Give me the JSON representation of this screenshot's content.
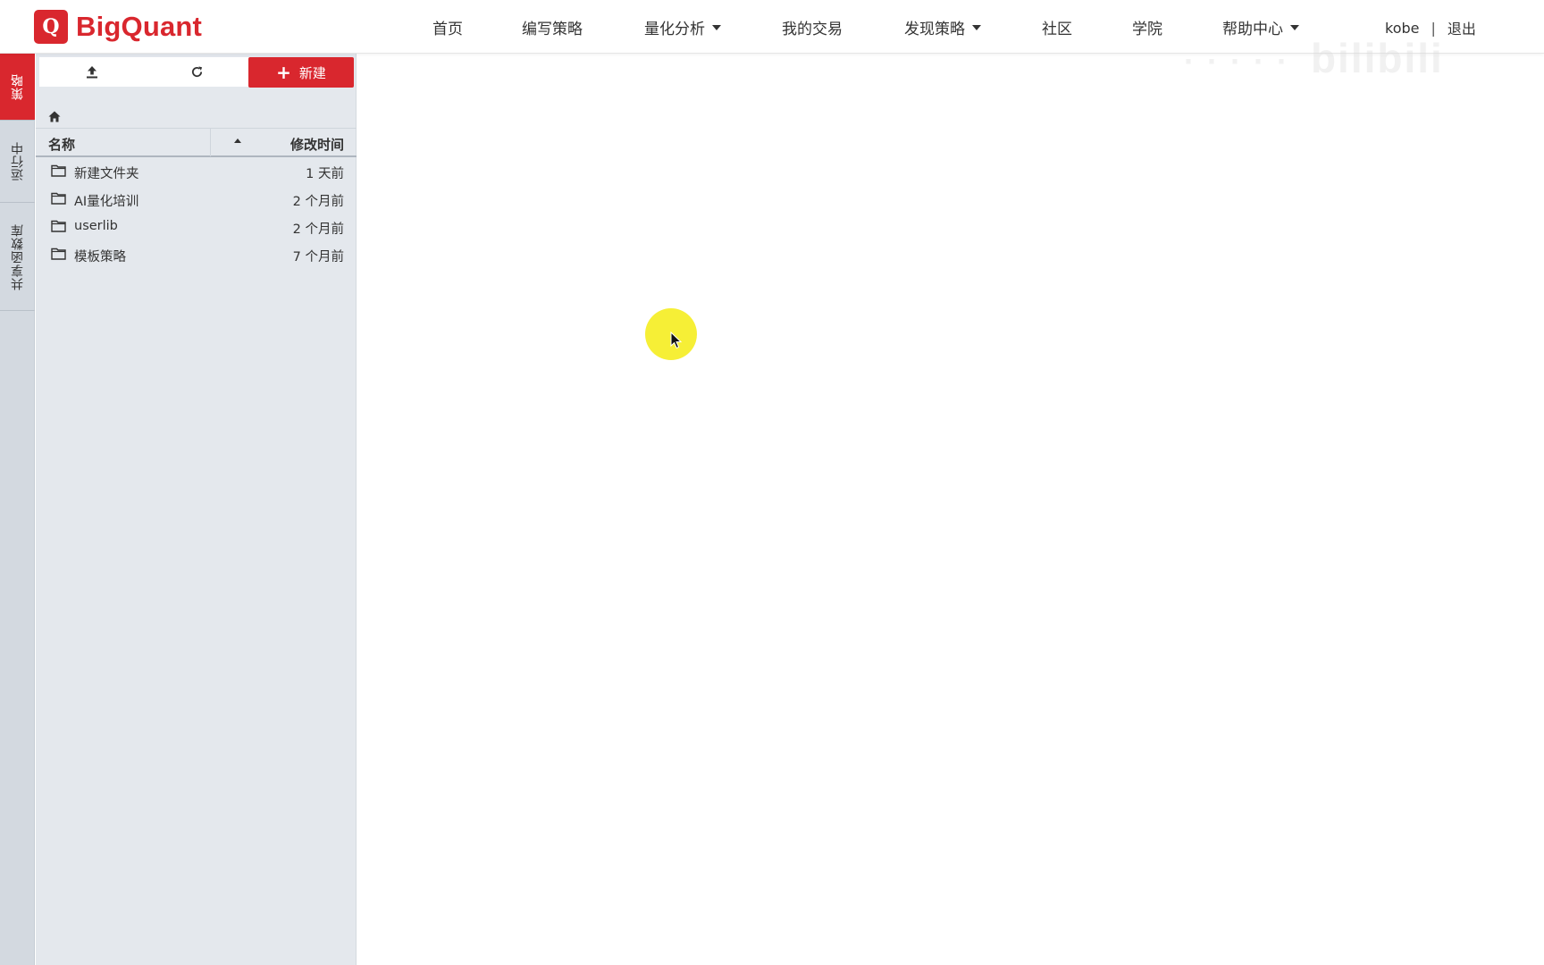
{
  "brand": {
    "logo_letter": "Q",
    "name": "BigQuant",
    "color": "#d9272e"
  },
  "nav": {
    "items": [
      {
        "label": "首页",
        "dropdown": false
      },
      {
        "label": "编写策略",
        "dropdown": false
      },
      {
        "label": "量化分析",
        "dropdown": true
      },
      {
        "label": "我的交易",
        "dropdown": false
      },
      {
        "label": "发现策略",
        "dropdown": true
      },
      {
        "label": "社区",
        "dropdown": false
      },
      {
        "label": "学院",
        "dropdown": false
      },
      {
        "label": "帮助中心",
        "dropdown": true
      }
    ],
    "user": "kobe",
    "separator": "|",
    "logout": "退出"
  },
  "watermark": "bilibili",
  "side_tabs": [
    {
      "label": "策略",
      "active": true
    },
    {
      "label": "运行中",
      "active": false
    },
    {
      "label": "共享函数库",
      "active": false
    }
  ],
  "file_panel": {
    "toolbar": {
      "upload_icon": "upload-icon",
      "refresh_icon": "refresh-icon"
    },
    "new_button": "新建",
    "breadcrumb_icon": "home-icon",
    "columns": {
      "name": "名称",
      "modified": "修改时间"
    },
    "rows": [
      {
        "name": "新建文件夹",
        "modified": "1 天前",
        "icon": "folder-icon"
      },
      {
        "name": "AI量化培训",
        "modified": "2 个月前",
        "icon": "folder-icon"
      },
      {
        "name": "userlib",
        "modified": "2 个月前",
        "icon": "folder-icon"
      },
      {
        "name": "模板策略",
        "modified": "7 个月前",
        "icon": "folder-icon"
      }
    ]
  },
  "colors": {
    "accent": "#d9272e",
    "panel_bg": "#e4e8ed",
    "tab_bg": "#d3d9e0",
    "cursor_highlight": "#f6ee2b"
  }
}
